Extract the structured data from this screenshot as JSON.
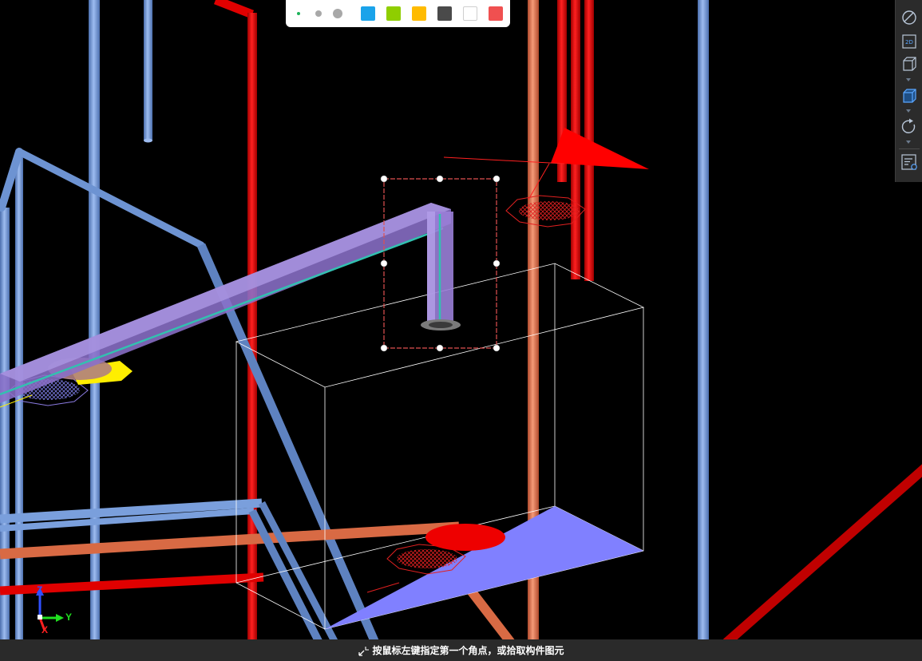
{
  "status_bar": {
    "prompt": "按鼠标左键指定第一个角点，或拾取构件图元",
    "icon": "select-cursor-icon"
  },
  "color_toolbar": {
    "line_widths": [
      "thin",
      "medium",
      "thick"
    ],
    "active_width": "thin",
    "swatches": [
      {
        "name": "blue",
        "color": "#1aa3ea"
      },
      {
        "name": "green",
        "color": "#8fce00"
      },
      {
        "name": "yellow",
        "color": "#ffbb00"
      },
      {
        "name": "dark-gray",
        "color": "#4a4a4a"
      },
      {
        "name": "white",
        "color": "#ffffff"
      },
      {
        "name": "red",
        "color": "#f05050"
      }
    ]
  },
  "view_toolbar": {
    "buttons": [
      "orbit-icon",
      "view-2d-icon",
      "view-3d-box-icon",
      "view-3d-shaded-icon",
      "rotate-icon",
      "properties-panel-icon"
    ],
    "view_2d_label": "2D"
  },
  "axis_gizmo": {
    "z_label": "Z",
    "y_label": "Y",
    "x_label": "X",
    "colors": {
      "x": "#ff2020",
      "y": "#20e020",
      "z": "#3050ff"
    }
  },
  "scene_colors": {
    "background": "#000000",
    "pipe_blue": "#6d93d2",
    "pipe_red": "#e00000",
    "pipe_orange": "#e0704a",
    "duct_purple": "#8a70c8",
    "selection": "#e05050",
    "triangle_fill": "#8080ff"
  }
}
